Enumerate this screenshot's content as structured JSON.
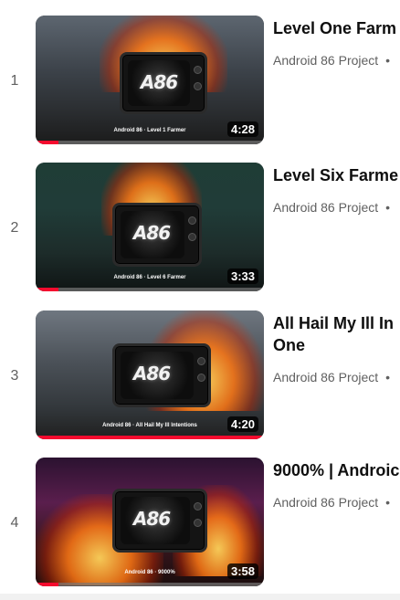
{
  "playlist": {
    "items": [
      {
        "index": "1",
        "title": "Level One Farm",
        "channel": "Android 86 Project",
        "separator": "•",
        "duration": "4:28",
        "thumb_caption": "Android 86 · Level 1 Farmer",
        "logo": "A86",
        "progress": 0.1
      },
      {
        "index": "2",
        "title": "Level Six Farme",
        "channel": "Android 86 Project",
        "separator": "•",
        "duration": "3:33",
        "thumb_caption": "Android 86 · Level 6 Farmer",
        "logo": "A86",
        "progress": 0.1
      },
      {
        "index": "3",
        "title": "All Hail My Ill In One",
        "channel": "Android 86 Project",
        "separator": "•",
        "duration": "4:20",
        "thumb_caption": "Android 86 · All Hail My Ill Intentions",
        "logo": "A86",
        "progress": 1.0
      },
      {
        "index": "4",
        "title": "9000% | Androic",
        "channel": "Android 86 Project",
        "separator": "•",
        "duration": "3:58",
        "thumb_caption": "Android 86 · 9000%",
        "logo": "A86",
        "progress": 0.1
      }
    ]
  },
  "colors": {
    "progress": "#f50b2e",
    "text_primary": "#0f0f0f",
    "text_secondary": "#606060"
  }
}
